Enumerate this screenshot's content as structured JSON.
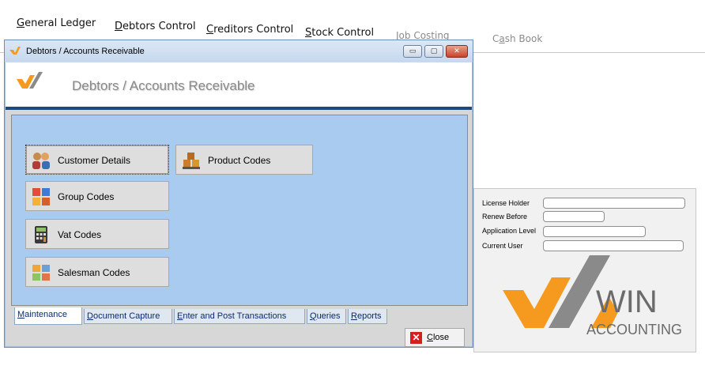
{
  "menu": {
    "items": [
      {
        "label": "General Ledger",
        "accel": "G",
        "rest": "eneral Ledger"
      },
      {
        "label": "Debtors Control",
        "accel": "D",
        "rest": "ebtors Control"
      },
      {
        "label": "Creditors Control",
        "accel": "C",
        "rest": "reditors Control"
      },
      {
        "label": "Stock Control",
        "accel": "S",
        "rest": "tock Control"
      },
      {
        "label": "Job Costing"
      },
      {
        "label": "Cash Book",
        "pre": "C",
        "accel": "a",
        "rest": "sh Book"
      }
    ]
  },
  "window": {
    "title": "Debtors / Accounts Receivable",
    "header_title": "Debtors / Accounts Receivable",
    "controls": {
      "minimize": "▭",
      "maximize": "▢",
      "close": "✕"
    }
  },
  "maintenance": {
    "buttons": [
      {
        "label": "Customer Details",
        "icon": "customer-icon"
      },
      {
        "label": "Product Codes",
        "icon": "product-icon"
      },
      {
        "label": "Group Codes",
        "icon": "group-icon"
      },
      {
        "label": "Vat Codes",
        "icon": "calculator-icon"
      },
      {
        "label": "Salesman Codes",
        "icon": "salesman-icon"
      }
    ]
  },
  "tabs": [
    {
      "label": "Maintenance",
      "accel": "M",
      "rest": "aintenance"
    },
    {
      "label": "Document Capture",
      "accel": "D",
      "rest": "ocument Capture"
    },
    {
      "label": "Enter and Post Transactions",
      "accel": "E",
      "rest": "nter and Post Transactions"
    },
    {
      "label": "Queries",
      "accel": "Q",
      "rest": "ueries"
    },
    {
      "label": "Reports",
      "accel": "R",
      "rest": "eports"
    }
  ],
  "close_button": {
    "label": "Close",
    "accel": "C",
    "rest": "lose"
  },
  "info": {
    "license_holder": "License Holder",
    "renew_before": "Renew Before",
    "application_level": "Application Level",
    "current_user": "Current User"
  },
  "logo": {
    "word1": "WIN",
    "word2": "ACCOUNTING"
  },
  "colors": {
    "panel_blue": "#a9cbef",
    "header_rule": "#1f4a78",
    "logo_orange": "#f59a1e",
    "logo_grey": "#707070"
  }
}
